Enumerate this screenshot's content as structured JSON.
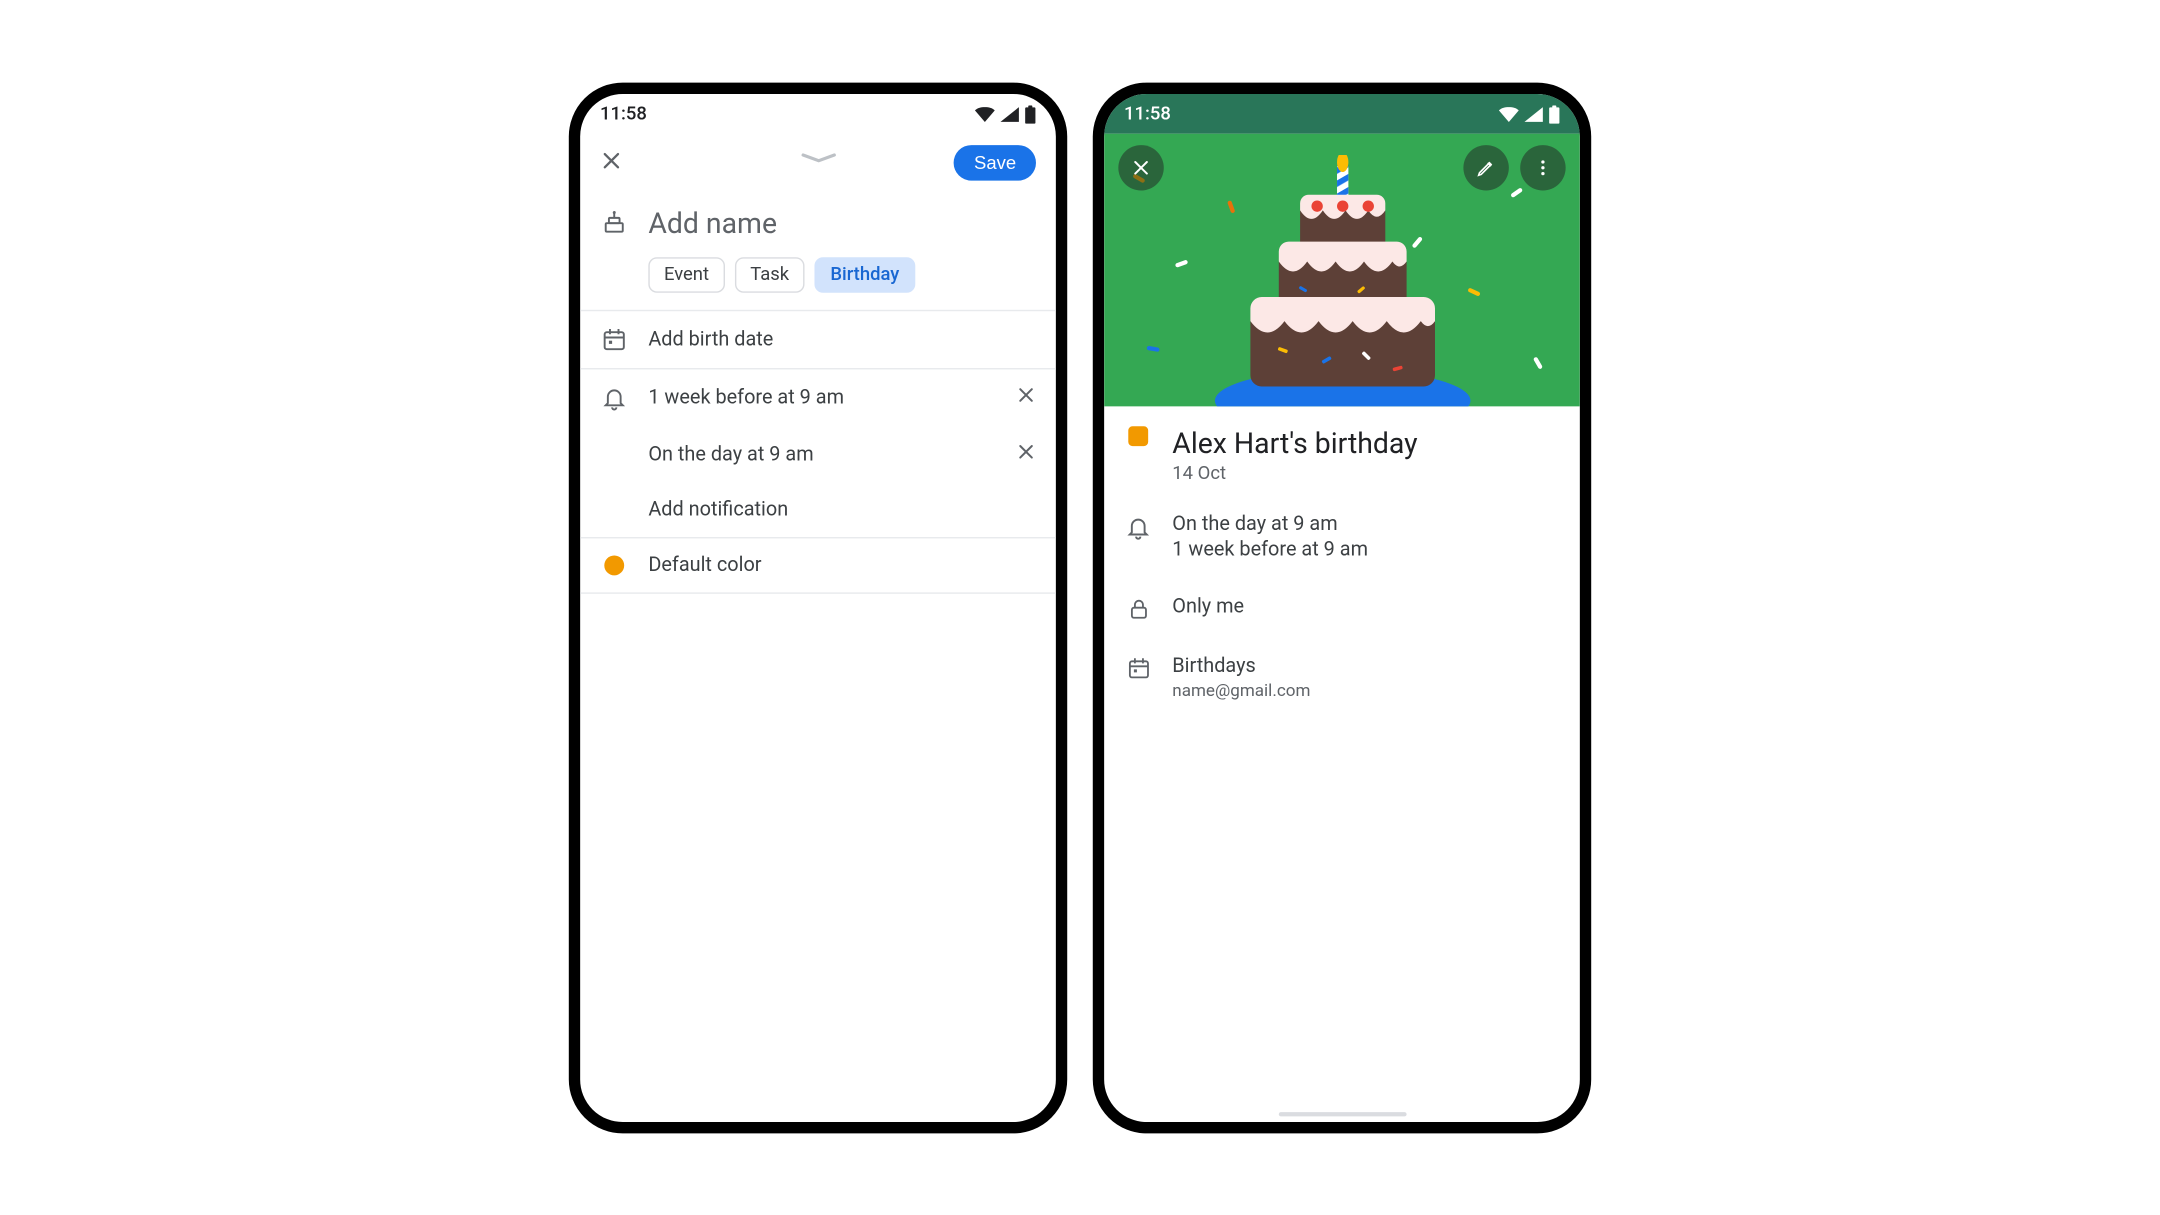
{
  "status": {
    "time": "11:58"
  },
  "create": {
    "save_label": "Save",
    "name_placeholder": "Add name",
    "chips": {
      "event": "Event",
      "task": "Task",
      "birthday": "Birthday"
    },
    "add_date_label": "Add birth date",
    "notifications": {
      "n1": "1 week before at 9 am",
      "n2": "On the day at 9 am",
      "add_label": "Add notification"
    },
    "color_label": "Default color"
  },
  "detail": {
    "title": "Alex Hart's birthday",
    "date": "14 Oct",
    "notifications": {
      "n1": "On the day at 9 am",
      "n2": "1 week before at 9 am"
    },
    "visibility": "Only me",
    "calendar": {
      "name": "Birthdays",
      "account": "name@gmail.com"
    }
  }
}
